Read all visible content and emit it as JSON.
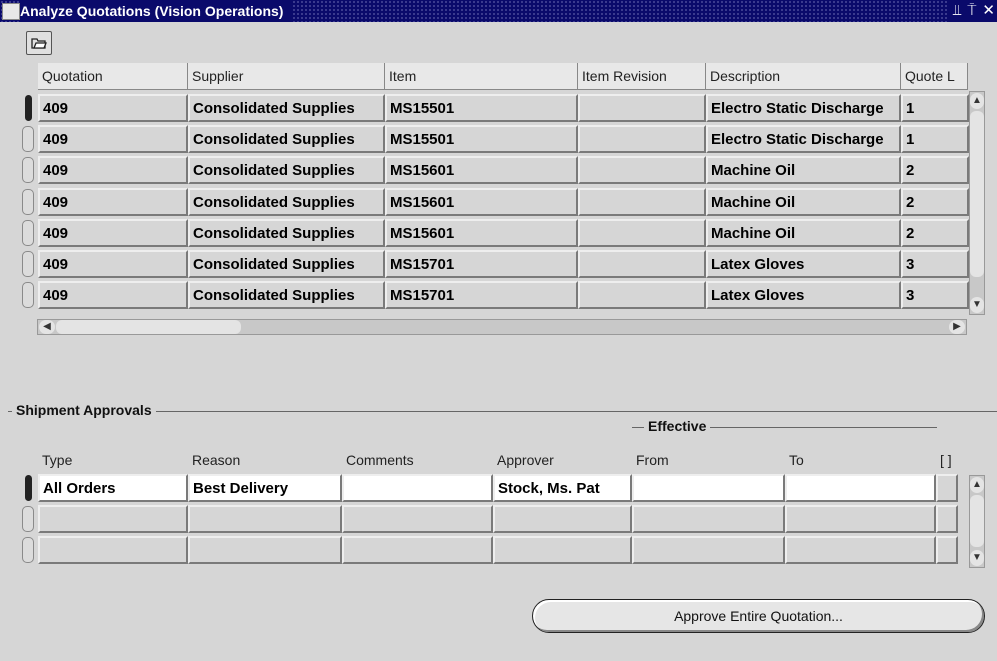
{
  "window": {
    "title": "Analyze Quotations (Vision Operations)",
    "controls": [
      "minimize",
      "maximize",
      "close"
    ],
    "app_icon_text": "ORACLE"
  },
  "toolbar": {
    "folder_icon": "folder-open-icon"
  },
  "quotes_table": {
    "columns": [
      "Quotation",
      "Supplier",
      "Item",
      "Item Revision",
      "Description",
      "Quote L"
    ],
    "rows": [
      [
        "409",
        "Consolidated Supplies",
        "MS15501",
        "",
        "Electro Static Discharge",
        "1"
      ],
      [
        "409",
        "Consolidated Supplies",
        "MS15501",
        "",
        "Electro Static Discharge",
        "1"
      ],
      [
        "409",
        "Consolidated Supplies",
        "MS15601",
        "",
        "Machine Oil",
        "2"
      ],
      [
        "409",
        "Consolidated Supplies",
        "MS15601",
        "",
        "Machine Oil",
        "2"
      ],
      [
        "409",
        "Consolidated Supplies",
        "MS15601",
        "",
        "Machine Oil",
        "2"
      ],
      [
        "409",
        "Consolidated Supplies",
        "MS15701",
        "",
        "Latex Gloves",
        "3"
      ],
      [
        "409",
        "Consolidated Supplies",
        "MS15701",
        "",
        "Latex Gloves",
        "3"
      ]
    ]
  },
  "shipment_approvals": {
    "title": "Shipment Approvals",
    "effective_label": "Effective",
    "columns": [
      "Type",
      "Reason",
      "Comments",
      "Approver",
      "From",
      "To",
      "[ ]"
    ],
    "rows": [
      [
        "All Orders",
        "Best Delivery",
        "",
        "Stock, Ms. Pat",
        "",
        ""
      ],
      [
        "",
        "",
        "",
        "",
        "",
        ""
      ],
      [
        "",
        "",
        "",
        "",
        "",
        ""
      ]
    ]
  },
  "actions": {
    "approve_label": "Approve Entire Quotation..."
  },
  "colors": {
    "title_bar": "#0a0a6b",
    "background": "#d6d6d6"
  }
}
